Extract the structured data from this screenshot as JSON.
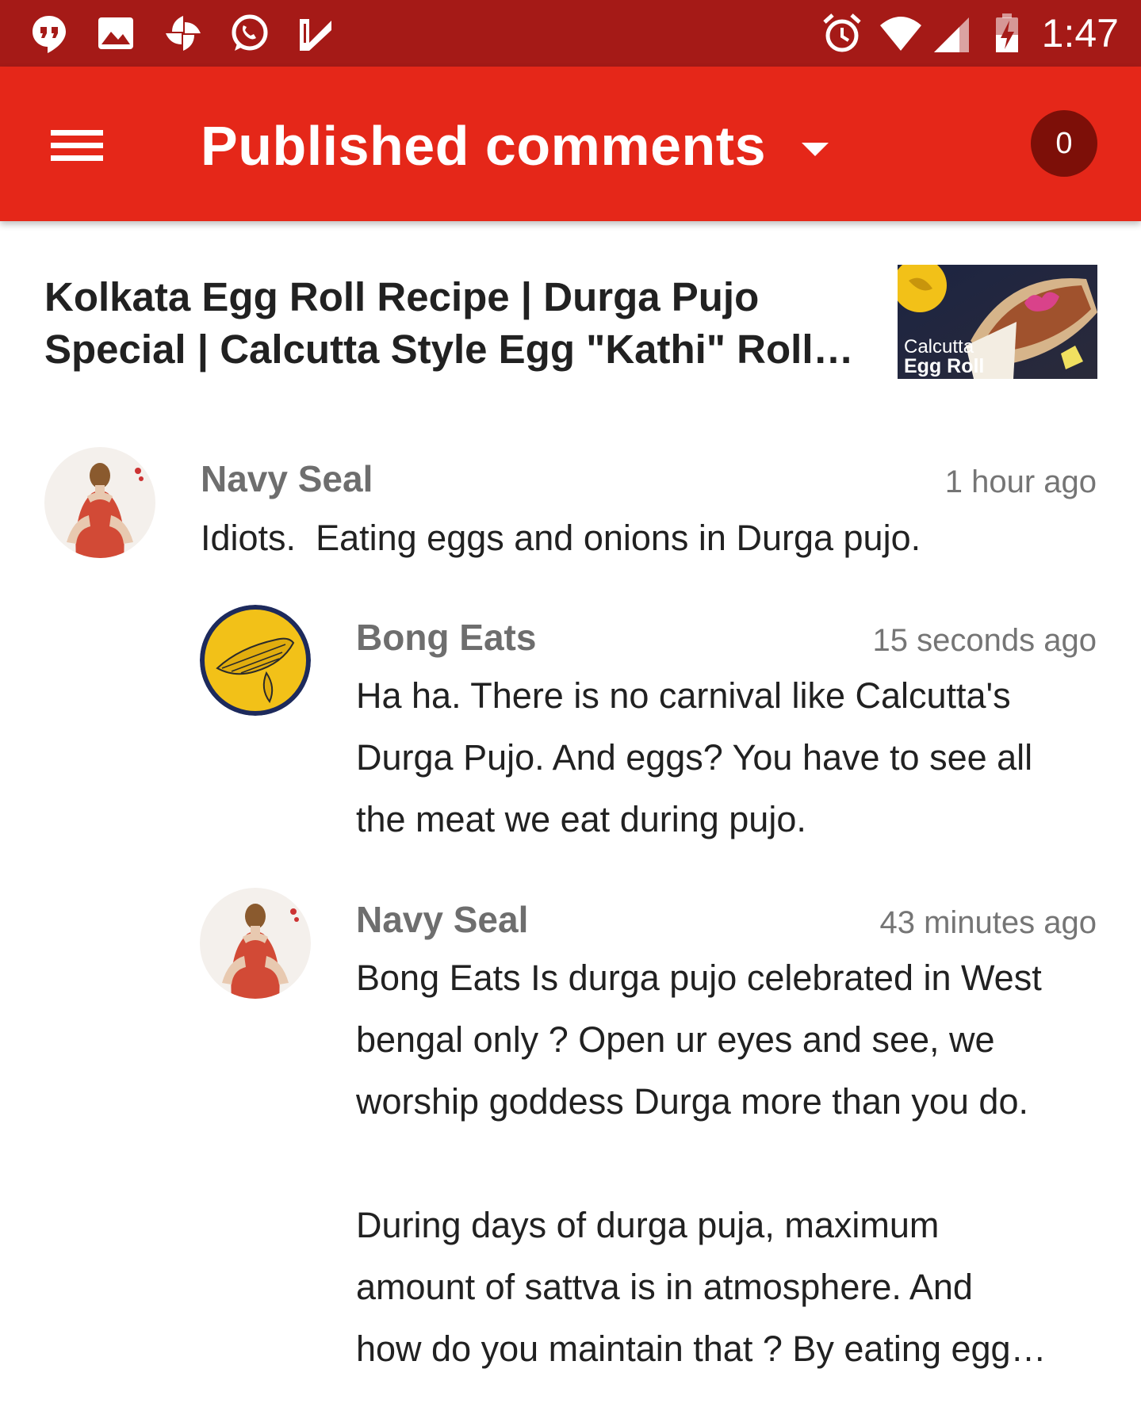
{
  "status_bar": {
    "icons": [
      "hangouts-icon",
      "image-icon",
      "pinwheel-icon",
      "whatsapp-icon",
      "checkmark-icon",
      "alarm-icon",
      "wifi-icon",
      "cell-signal-icon",
      "battery-charging-icon"
    ],
    "time": "1:47"
  },
  "app_bar": {
    "menu_icon": "hamburger-menu-icon",
    "title": "Published comments",
    "dropdown_icon": "dropdown-arrow-icon",
    "count": "0"
  },
  "video": {
    "title": "Kolkata Egg Roll Recipe | Durga Pujo Special | Calcutta Style Egg \"Kathi\" Roll…",
    "thumbnail_caption_line1": "Calcutta",
    "thumbnail_caption_line2": "Egg Roll"
  },
  "comments": [
    {
      "author": "Navy Seal",
      "time": "1 hour ago",
      "text": "Idiots.  Eating eggs and onions in Durga pujo.",
      "replies": [
        {
          "author": "Bong Eats",
          "time": "15 seconds ago",
          "text": "Ha ha. There is no carnival like Calcutta's\nDurga Pujo. And eggs? You have to see all\nthe meat we eat during pujo."
        },
        {
          "author": "Navy Seal",
          "time": "43 minutes ago",
          "text": "Bong Eats Is durga pujo celebrated in West\nbengal only ? Open ur eyes and see, we\nworship goddess Durga more than you do.\n\nDuring days of durga puja, maximum\namount of sattva is in atmosphere. And\nhow do you maintain that ? By eating egg…"
        }
      ]
    }
  ],
  "colors": {
    "status_bar": "#a51a17",
    "app_bar": "#e52719",
    "badge": "#7d0f08",
    "channel_avatar_bg": "#f2c118",
    "channel_avatar_ring": "#1d2a5c"
  }
}
